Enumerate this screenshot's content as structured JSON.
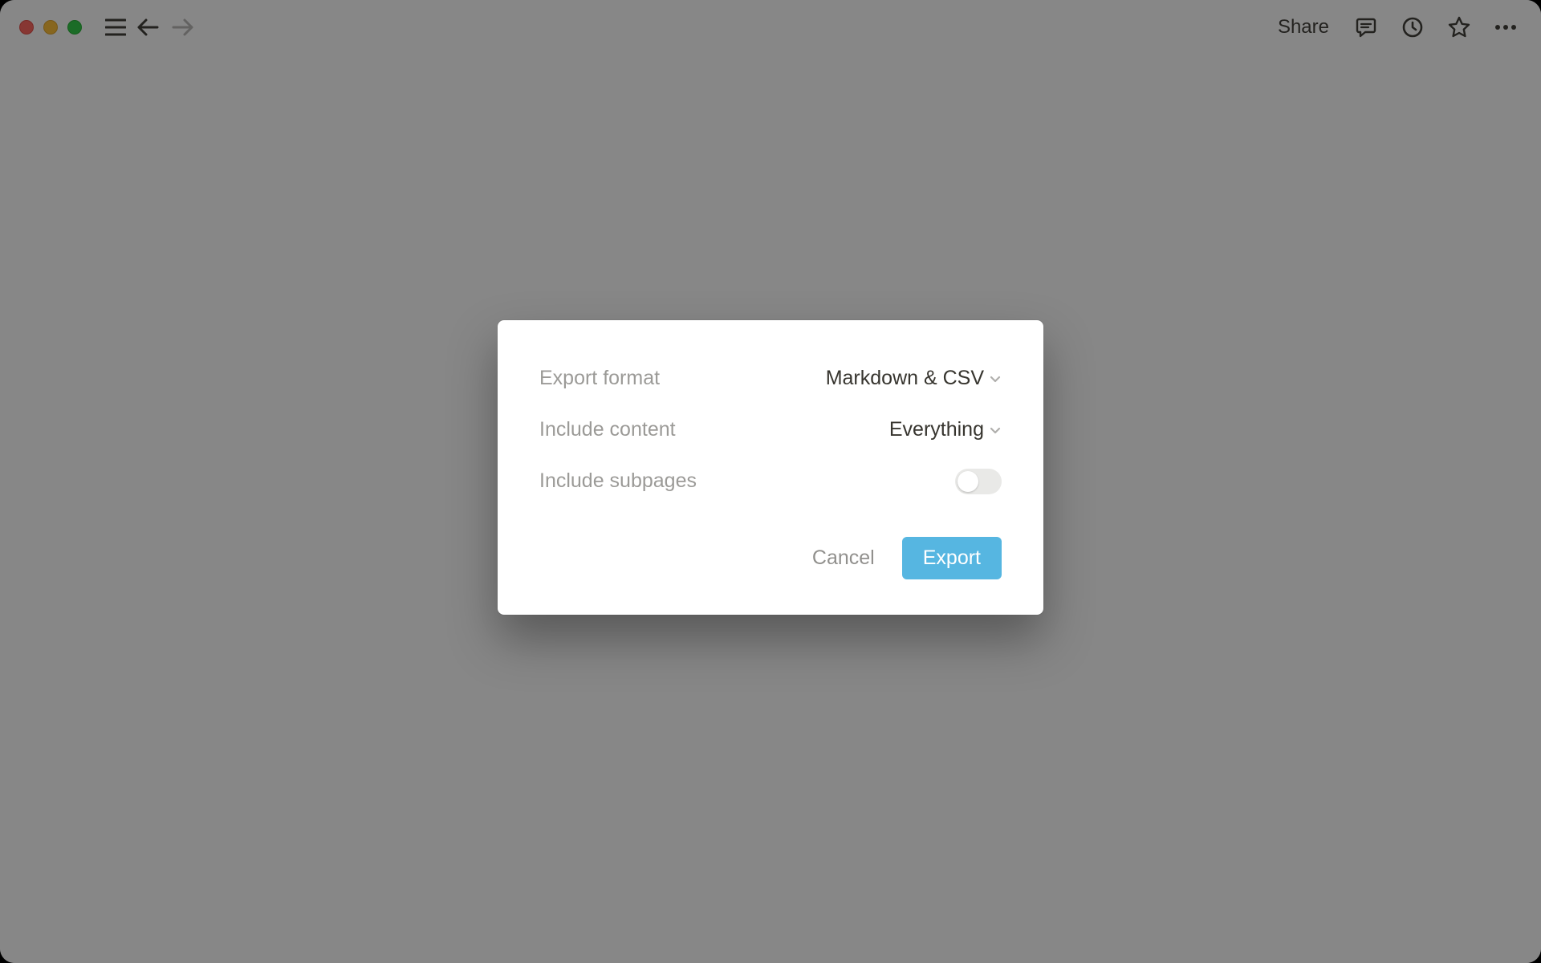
{
  "topbar": {
    "share_label": "Share"
  },
  "modal": {
    "export_format_label": "Export format",
    "export_format_value": "Markdown & CSV",
    "include_content_label": "Include content",
    "include_content_value": "Everything",
    "include_subpages_label": "Include subpages",
    "include_subpages_on": false,
    "cancel_label": "Cancel",
    "export_label": "Export"
  }
}
